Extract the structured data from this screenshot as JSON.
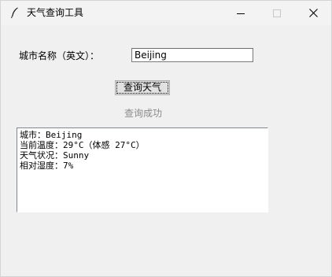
{
  "window": {
    "title": "天气查询工具",
    "icons": {
      "app": "feather-icon",
      "minimize": "minimize-icon",
      "maximize": "maximize-icon",
      "close": "close-icon"
    }
  },
  "form": {
    "city_label": "城市名称（英文）：",
    "city_value": "Beijing",
    "query_button": "查询天气"
  },
  "status": {
    "text": "查询成功",
    "color": "#8a8a8a"
  },
  "result": {
    "lines": [
      "城市：Beijing",
      "当前温度：29°C（体感 27°C）",
      "天气状况：Sunny",
      "相对湿度：7%"
    ]
  }
}
